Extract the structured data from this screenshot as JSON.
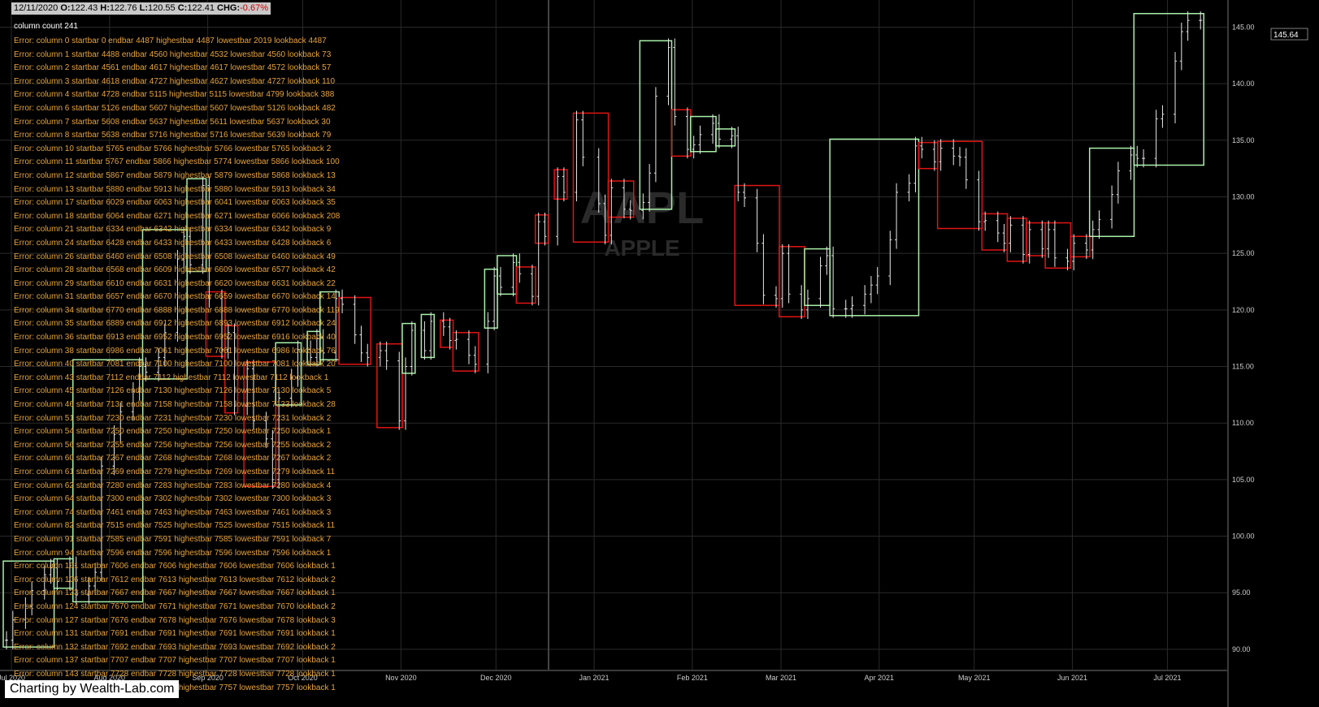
{
  "header": {
    "date": "12/11/2020",
    "open_label": "O:",
    "open": "122.43",
    "high_label": "H:",
    "high": "122.76",
    "low_label": "L:",
    "low": "120.55",
    "close_label": "C:",
    "close": "122.41",
    "chg_label": "CHG:",
    "chg": "-0.67%"
  },
  "column_count": "column count 241",
  "errors": [
    "Error: column 0 startbar 0 endbar 4487 highestbar 4487 lowestbar 2019 lookback 4487",
    "Error: column 1 startbar 4488 endbar 4560 highestbar 4532 lowestbar 4560 lookback 73",
    "Error: column 2 startbar 4561 endbar 4617 highestbar 4617 lowestbar 4572 lookback 57",
    "Error: column 3 startbar 4618 endbar 4727 highestbar 4627 lowestbar 4727 lookback 110",
    "Error: column 4 startbar 4728 endbar 5115 highestbar 5115 lowestbar 4799 lookback 388",
    "Error: column 6 startbar 5126 endbar 5607 highestbar 5607 lowestbar 5126 lookback 482",
    "Error: column 7 startbar 5608 endbar 5637 highestbar 5611 lowestbar 5637 lookback 30",
    "Error: column 8 startbar 5638 endbar 5716 highestbar 5716 lowestbar 5639 lookback 79",
    "Error: column 10 startbar 5765 endbar 5766 highestbar 5766 lowestbar 5765 lookback 2",
    "Error: column 11 startbar 5767 endbar 5866 highestbar 5774 lowestbar 5866 lookback 100",
    "Error: column 12 startbar 5867 endbar 5879 highestbar 5879 lowestbar 5868 lookback 13",
    "Error: column 13 startbar 5880 endbar 5913 highestbar 5880 lowestbar 5913 lookback 34",
    "Error: column 17 startbar 6029 endbar 6063 highestbar 6041 lowestbar 6063 lookback 35",
    "Error: column 18 startbar 6064 endbar 6271 highestbar 6271 lowestbar 6066 lookback 208",
    "Error: column 21 startbar 6334 endbar 6342 highestbar 6334 lowestbar 6342 lookback 9",
    "Error: column 24 startbar 6428 endbar 6433 highestbar 6433 lowestbar 6428 lookback 6",
    "Error: column 26 startbar 6460 endbar 6508 highestbar 6508 lowestbar 6460 lookback 49",
    "Error: column 28 startbar 6568 endbar 6609 highestbar 6609 lowestbar 6577 lookback 42",
    "Error: column 29 startbar 6610 endbar 6631 highestbar 6620 lowestbar 6631 lookback 22",
    "Error: column 31 startbar 6657 endbar 6670 highestbar 6659 lowestbar 6670 lookback 14",
    "Error: column 34 startbar 6770 endbar 6888 highestbar 6888 lowestbar 6770 lookback 119",
    "Error: column 35 startbar 6889 endbar 6912 highestbar 6893 lowestbar 6912 lookback 24",
    "Error: column 36 startbar 6913 endbar 6952 highestbar 6952 lowestbar 6916 lookback 40",
    "Error: column 38 startbar 6986 endbar 7061 highestbar 7061 lowestbar 6986 lookback 76",
    "Error: column 40 startbar 7081 endbar 7100 highestbar 7100 lowestbar 7081 lookback 20",
    "Error: column 43 startbar 7112 endbar 7112 highestbar 7112 lowestbar 7112 lookback 1",
    "Error: column 45 startbar 7126 endbar 7130 highestbar 7126 lowestbar 7130 lookback 5",
    "Error: column 46 startbar 7131 endbar 7158 highestbar 7158 lowestbar 7133 lookback 28",
    "Error: column 51 startbar 7230 endbar 7231 highestbar 7230 lowestbar 7231 lookback 2",
    "Error: column 54 startbar 7250 endbar 7250 highestbar 7250 lowestbar 7250 lookback 1",
    "Error: column 56 startbar 7255 endbar 7256 highestbar 7256 lowestbar 7255 lookback 2",
    "Error: column 60 startbar 7267 endbar 7268 highestbar 7268 lowestbar 7267 lookback 2",
    "Error: column 61 startbar 7269 endbar 7279 highestbar 7269 lowestbar 7279 lookback 11",
    "Error: column 62 startbar 7280 endbar 7283 highestbar 7283 lowestbar 7280 lookback 4",
    "Error: column 64 startbar 7300 endbar 7302 highestbar 7302 lowestbar 7300 lookback 3",
    "Error: column 74 startbar 7461 endbar 7463 highestbar 7463 lowestbar 7461 lookback 3",
    "Error: column 82 startbar 7515 endbar 7525 highestbar 7525 lowestbar 7515 lookback 11",
    "Error: column 91 startbar 7585 endbar 7591 highestbar 7585 lowestbar 7591 lookback 7",
    "Error: column 94 startbar 7596 endbar 7596 highestbar 7596 lowestbar 7596 lookback 1",
    "Error: column 101 startbar 7606 endbar 7606 highestbar 7606 lowestbar 7606 lookback 1",
    "Error: column 106 startbar 7612 endbar 7613 highestbar 7613 lowestbar 7612 lookback 2",
    "Error: column 123 startbar 7667 endbar 7667 highestbar 7667 lowestbar 7667 lookback 1",
    "Error: column 124 startbar 7670 endbar 7671 highestbar 7671 lowestbar 7670 lookback 2",
    "Error: column 127 startbar 7676 endbar 7678 highestbar 7676 lowestbar 7678 lookback 3",
    "Error: column 131 startbar 7691 endbar 7691 highestbar 7691 lowestbar 7691 lookback 1",
    "Error: column 132 startbar 7692 endbar 7693 highestbar 7693 lowestbar 7692 lookback 2",
    "Error: column 137 startbar 7707 endbar 7707 highestbar 7707 lowestbar 7707 lookback 1",
    "Error: column 143 startbar 7728 endbar 7728 highestbar 7728 lowestbar 7728 lookback 1",
    "Error: column 151 startbar 7757 endbar 7757 highestbar 7757 lowestbar 7757 lookback 1"
  ],
  "credit": "Charting by Wealth-Lab.com",
  "watermark": {
    "symbol": "AAPL",
    "name": "APPLE"
  },
  "last_price_label": "145.64",
  "colors": {
    "up_box": "#a8f0a8",
    "down_box": "#e01414",
    "bar": "#e8e8e8",
    "grid": "#2a2a2a",
    "error_text": "#e8a33a"
  },
  "chart_data": {
    "type": "ohlc_point_and_figure_overlay",
    "y_axis": {
      "ticks": [
        90,
        95,
        100,
        105,
        110,
        115,
        120,
        125,
        130,
        135,
        140,
        145
      ],
      "tick_labels": [
        "90.00",
        "95.00",
        "100.00",
        "105.00",
        "110.00",
        "115.00",
        "120.00",
        "125.00",
        "130.00",
        "135.00",
        "140.00",
        "145.00"
      ],
      "range": [
        88.2,
        147.4
      ]
    },
    "x_axis": {
      "labels": [
        "Jul 2020",
        "Aug 2020",
        "Sep 2020",
        "Oct 2020",
        "Nov 2020",
        "Dec 2020",
        "Jan 2021",
        "Feb 2021",
        "Mar 2021",
        "Apr 2021",
        "May 2021",
        "Jun 2021",
        "Jul 2021"
      ],
      "start": "2020-07-01",
      "end": "2021-07-15"
    },
    "grid": true,
    "series": [
      {
        "x": [
          "2020-07-01",
          "2020-07-03",
          "2020-07-07",
          "2020-07-09",
          "2020-07-13",
          "2020-07-15",
          "2020-07-17",
          "2020-07-21",
          "2020-07-23",
          "2020-07-27",
          "2020-07-29",
          "2020-07-31",
          "2020-08-04",
          "2020-08-06",
          "2020-08-10",
          "2020-08-12",
          "2020-08-14",
          "2020-08-18",
          "2020-08-20",
          "2020-08-24",
          "2020-08-26",
          "2020-08-28",
          "2020-09-01",
          "2020-09-03",
          "2020-09-07",
          "2020-09-09",
          "2020-09-11",
          "2020-09-15",
          "2020-09-17",
          "2020-09-21",
          "2020-09-23",
          "2020-09-25",
          "2020-09-29",
          "2020-10-01",
          "2020-10-05",
          "2020-10-07",
          "2020-10-09",
          "2020-10-13",
          "2020-10-15",
          "2020-10-19",
          "2020-10-21",
          "2020-10-23",
          "2020-10-27",
          "2020-10-29",
          "2020-11-02",
          "2020-11-04",
          "2020-11-06",
          "2020-11-10",
          "2020-11-12",
          "2020-11-16",
          "2020-11-18",
          "2020-11-20",
          "2020-11-24",
          "2020-11-26",
          "2020-11-30",
          "2020-12-02",
          "2020-12-04",
          "2020-12-08",
          "2020-12-10",
          "2020-12-14",
          "2020-12-16",
          "2020-12-18",
          "2020-12-22",
          "2020-12-24",
          "2020-12-28",
          "2020-12-30",
          "2021-01-04",
          "2021-01-06",
          "2021-01-08",
          "2021-01-12",
          "2021-01-14",
          "2021-01-18",
          "2021-01-20",
          "2021-01-22",
          "2021-01-26",
          "2021-01-28",
          "2021-02-01",
          "2021-02-03",
          "2021-02-05",
          "2021-02-09",
          "2021-02-11",
          "2021-02-15",
          "2021-02-17",
          "2021-02-19",
          "2021-02-23",
          "2021-02-25",
          "2021-03-01",
          "2021-03-03",
          "2021-03-05",
          "2021-03-09",
          "2021-03-11",
          "2021-03-15",
          "2021-03-17",
          "2021-03-19",
          "2021-03-23",
          "2021-03-25",
          "2021-03-29",
          "2021-03-31",
          "2021-04-02",
          "2021-04-06",
          "2021-04-08",
          "2021-04-12",
          "2021-04-14",
          "2021-04-16",
          "2021-04-20",
          "2021-04-22",
          "2021-04-26",
          "2021-04-28",
          "2021-04-30",
          "2021-05-04",
          "2021-05-06",
          "2021-05-10",
          "2021-05-12",
          "2021-05-14",
          "2021-05-18",
          "2021-05-20",
          "2021-05-24",
          "2021-05-26",
          "2021-05-28",
          "2021-06-01",
          "2021-06-03",
          "2021-06-07",
          "2021-06-09",
          "2021-06-11",
          "2021-06-15",
          "2021-06-17",
          "2021-06-21",
          "2021-06-23",
          "2021-06-25",
          "2021-06-29",
          "2021-07-01",
          "2021-07-05",
          "2021-07-07",
          "2021-07-09",
          "2021-07-13"
        ],
        "name": "",
        "close": [
          90.8,
          92.6,
          93.8,
          95.2,
          96.6,
          97.2,
          96.0,
          97.4,
          94.8,
          95.6,
          96.8,
          106.2,
          109.0,
          111.0,
          112.8,
          115.0,
          114.5,
          115.8,
          118.0,
          124.5,
          126.5,
          124.0,
          131.0,
          121.0,
          116.5,
          118.0,
          111.5,
          114.8,
          110.2,
          108.6,
          105.0,
          112.2,
          114.0,
          116.5,
          115.8,
          117.5,
          116.2,
          121.0,
          120.5,
          117.8,
          116.2,
          115.8,
          116.4,
          115.5,
          110.2,
          115.0,
          118.2,
          116.4,
          119.0,
          118.5,
          117.3,
          117.4,
          116.0,
          115.2,
          119.0,
          123.0,
          122.0,
          124.2,
          123.2,
          121.2,
          127.8,
          126.5,
          131.8,
          130.4,
          136.8,
          133.5,
          129.4,
          126.6,
          130.8,
          128.9,
          128.8,
          129.5,
          132.1,
          138.9,
          143.2,
          137.1,
          134.2,
          134.6,
          135.5,
          136.5,
          135.1,
          135.4,
          130.4,
          129.9,
          125.9,
          121.3,
          121.0,
          125.0,
          121.4,
          120.0,
          121.0,
          123.9,
          124.8,
          120.1,
          120.1,
          120.4,
          121.4,
          122.2,
          123.0,
          126.2,
          130.4,
          131.2,
          134.5,
          134.2,
          133.1,
          134.3,
          133.6,
          133.5,
          131.5,
          127.8,
          127.9,
          126.8,
          125.9,
          127.5,
          124.9,
          127.1,
          125.4,
          127.1,
          124.6,
          124.3,
          125.9,
          125.3,
          127.1,
          128.0,
          130.2,
          132.3,
          133.7,
          133.4,
          133.4,
          136.9,
          137.3,
          142.0,
          144.6,
          145.6,
          145.6
        ]
      }
    ],
    "boxes_note": "Green = rising column, red = falling column (price ranges)"
  }
}
